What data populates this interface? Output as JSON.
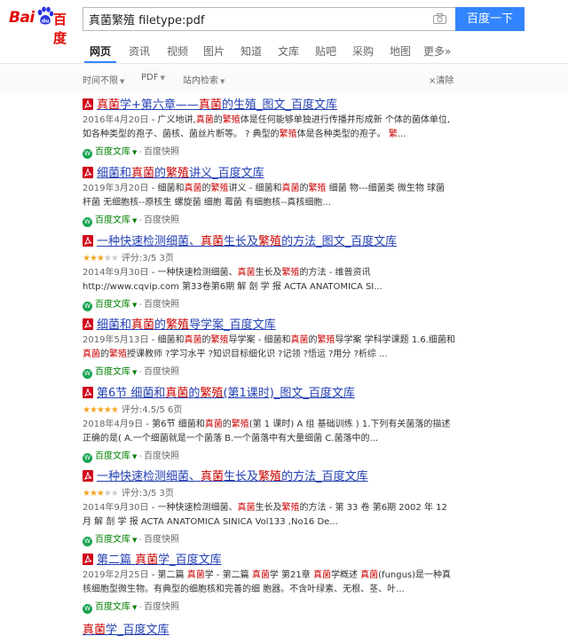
{
  "logo": {
    "left": "Bai",
    "right": "百度",
    "alt": "Baidu"
  },
  "search": {
    "query": "真菌繁殖 filetype:pdf",
    "button": "百度一下"
  },
  "nav": {
    "tabs": [
      "网页",
      "资讯",
      "视频",
      "图片",
      "知道",
      "文库",
      "贴吧",
      "采购",
      "地图",
      "更多»"
    ],
    "active_tab": "网页"
  },
  "filters": {
    "time": "时间不限",
    "type": "PDF",
    "site": "站内检索",
    "clear": "×清除"
  },
  "results": [
    {
      "title_parts": [
        {
          "t": "真菌",
          "em": true
        },
        {
          "t": "学+第六章——",
          "em": false
        },
        {
          "t": "真菌",
          "em": true
        },
        {
          "t": "的生殖_图文_百度文库",
          "em": false
        }
      ],
      "rating": null,
      "date": "2016年4月20日",
      "abstract_parts": [
        {
          "t": " - 广义地讲,",
          "em": false
        },
        {
          "t": "真菌",
          "em": true
        },
        {
          "t": "的",
          "em": false
        },
        {
          "t": "繁殖",
          "em": true
        },
        {
          "t": "体是任何能够单独进行传播并形成新 个体的菌体单位,如各种类型的孢子、菌核、菌丝片断等。 ? 典型的",
          "em": false
        },
        {
          "t": "繁殖",
          "em": true
        },
        {
          "t": "体是各种类型的孢子。 ",
          "em": false
        },
        {
          "t": "繁",
          "em": true
        },
        {
          "t": "...",
          "em": false
        }
      ],
      "source": "百度文库",
      "snapshot": "百度快照"
    },
    {
      "title_parts": [
        {
          "t": "细菌和",
          "em": false
        },
        {
          "t": "真菌",
          "em": true
        },
        {
          "t": "的",
          "em": false
        },
        {
          "t": "繁殖",
          "em": true
        },
        {
          "t": "讲义_百度文库",
          "em": false
        }
      ],
      "rating": null,
      "date": "2019年3月20日",
      "abstract_parts": [
        {
          "t": " - 细菌和",
          "em": false
        },
        {
          "t": "真菌",
          "em": true
        },
        {
          "t": "的",
          "em": false
        },
        {
          "t": "繁殖",
          "em": true
        },
        {
          "t": "讲义 - 细菌和",
          "em": false
        },
        {
          "t": "真菌",
          "em": true
        },
        {
          "t": "的",
          "em": false
        },
        {
          "t": "繁殖",
          "em": true
        },
        {
          "t": " 细菌 物---细菌类 微生物 球菌 杆菌 无细胞核--原核生 螺旋菌 细胞 霉菌 有细胞核--真核细胞...",
          "em": false
        }
      ],
      "source": "百度文库",
      "snapshot": "百度快照"
    },
    {
      "title_parts": [
        {
          "t": "一种快速检测细菌、",
          "em": false
        },
        {
          "t": "真菌",
          "em": true
        },
        {
          "t": "生长及",
          "em": false
        },
        {
          "t": "繁殖",
          "em": true
        },
        {
          "t": "的方法_图文_百度文库",
          "em": false
        }
      ],
      "rating": {
        "stars": 3,
        "text": "评分:3/5 3页"
      },
      "date": "2014年9月30日",
      "abstract_parts": [
        {
          "t": " - 一种快速检测细菌、",
          "em": false
        },
        {
          "t": "真菌",
          "em": true
        },
        {
          "t": "生长及",
          "em": false
        },
        {
          "t": "繁殖",
          "em": true
        },
        {
          "t": "的方法 - 维普资讯 http://www.cqvip.com 第33卷第6期 解 剖 学 报 ACTA ANATOMICA SI...",
          "em": false
        }
      ],
      "source": "百度文库",
      "snapshot": "百度快照"
    },
    {
      "title_parts": [
        {
          "t": "细菌和",
          "em": false
        },
        {
          "t": "真菌",
          "em": true
        },
        {
          "t": "的",
          "em": false
        },
        {
          "t": "繁殖",
          "em": true
        },
        {
          "t": "导学案_百度文库",
          "em": false
        }
      ],
      "rating": null,
      "date": "2019年5月13日",
      "abstract_parts": [
        {
          "t": " - 细菌和",
          "em": false
        },
        {
          "t": "真菌",
          "em": true
        },
        {
          "t": "的",
          "em": false
        },
        {
          "t": "繁殖",
          "em": true
        },
        {
          "t": "导学案 - 细菌和",
          "em": false
        },
        {
          "t": "真菌",
          "em": true
        },
        {
          "t": "的",
          "em": false
        },
        {
          "t": "繁殖",
          "em": true
        },
        {
          "t": "导学案 学科学课题 1.6.细菌和",
          "em": false
        },
        {
          "t": "真菌",
          "em": true
        },
        {
          "t": "的",
          "em": false
        },
        {
          "t": "繁殖",
          "em": true
        },
        {
          "t": "授课教师 ?学习水平 ?知识目标细化识 ?记领 ?悟运 ?用分 ?析综 ...",
          "em": false
        }
      ],
      "source": "百度文库",
      "snapshot": "百度快照"
    },
    {
      "title_parts": [
        {
          "t": "第6节 细菌和",
          "em": false
        },
        {
          "t": "真菌",
          "em": true
        },
        {
          "t": "的",
          "em": false
        },
        {
          "t": "繁殖",
          "em": true
        },
        {
          "t": "(第1课时)_图文_百度文库",
          "em": false
        }
      ],
      "rating": {
        "stars": 4.5,
        "text": "评分:4.5/5 6页"
      },
      "date": "2018年4月9日",
      "abstract_parts": [
        {
          "t": " - 第6节 细菌和",
          "em": false
        },
        {
          "t": "真菌",
          "em": true
        },
        {
          "t": "的",
          "em": false
        },
        {
          "t": "繁殖",
          "em": true
        },
        {
          "t": "(第 1 课时) A 组 基础训练 ) 1.下列有关菌落的描述正确的是( A.一个细菌就是一个菌落 B.一个菌落中有大量细菌 C.菌落中的...",
          "em": false
        }
      ],
      "source": "百度文库",
      "snapshot": "百度快照"
    },
    {
      "title_parts": [
        {
          "t": "一种快速检测细菌、",
          "em": false
        },
        {
          "t": "真菌",
          "em": true
        },
        {
          "t": "生长及",
          "em": false
        },
        {
          "t": "繁殖",
          "em": true
        },
        {
          "t": "的方法_百度文库",
          "em": false
        }
      ],
      "rating": {
        "stars": 3,
        "text": "评分:3/5 3页"
      },
      "date": "2014年9月30日",
      "abstract_parts": [
        {
          "t": " - 一种快速检测细菌、",
          "em": false
        },
        {
          "t": "真菌",
          "em": true
        },
        {
          "t": "生长及",
          "em": false
        },
        {
          "t": "繁殖",
          "em": true
        },
        {
          "t": "的方法 - 第 33 卷 第6期 2002 年 12 月 解 剖 学 报 ACTA ANATOMICA SINICA Vol133 ,No16 De...",
          "em": false
        }
      ],
      "source": "百度文库",
      "snapshot": "百度快照"
    },
    {
      "title_parts": [
        {
          "t": "第二篇 ",
          "em": false
        },
        {
          "t": "真菌",
          "em": true
        },
        {
          "t": "学_百度文库",
          "em": false
        }
      ],
      "rating": null,
      "date": "2019年2月25日",
      "abstract_parts": [
        {
          "t": " - 第二篇 ",
          "em": false
        },
        {
          "t": "真菌",
          "em": true
        },
        {
          "t": "学 - 第二篇 ",
          "em": false
        },
        {
          "t": "真菌",
          "em": true
        },
        {
          "t": "学 第21章 ",
          "em": false
        },
        {
          "t": "真菌",
          "em": true
        },
        {
          "t": "学概述 ",
          "em": false
        },
        {
          "t": "真菌",
          "em": true
        },
        {
          "t": "(fungus)是一种真核细胞型微生物。有典型的细胞核和完善的细 胞器。不含叶绿素、无根、茎、叶...",
          "em": false
        }
      ],
      "source": "百度文库",
      "snapshot": "百度快照"
    }
  ],
  "partial_result": {
    "title_parts": [
      {
        "t": "真菌",
        "em": true
      },
      {
        "t": "学_百度文库",
        "em": false
      }
    ]
  },
  "colors": {
    "accent": "#3385ff",
    "link": "#2440b3",
    "highlight": "#c00000",
    "source": "#008000",
    "star": "#f5a623"
  }
}
